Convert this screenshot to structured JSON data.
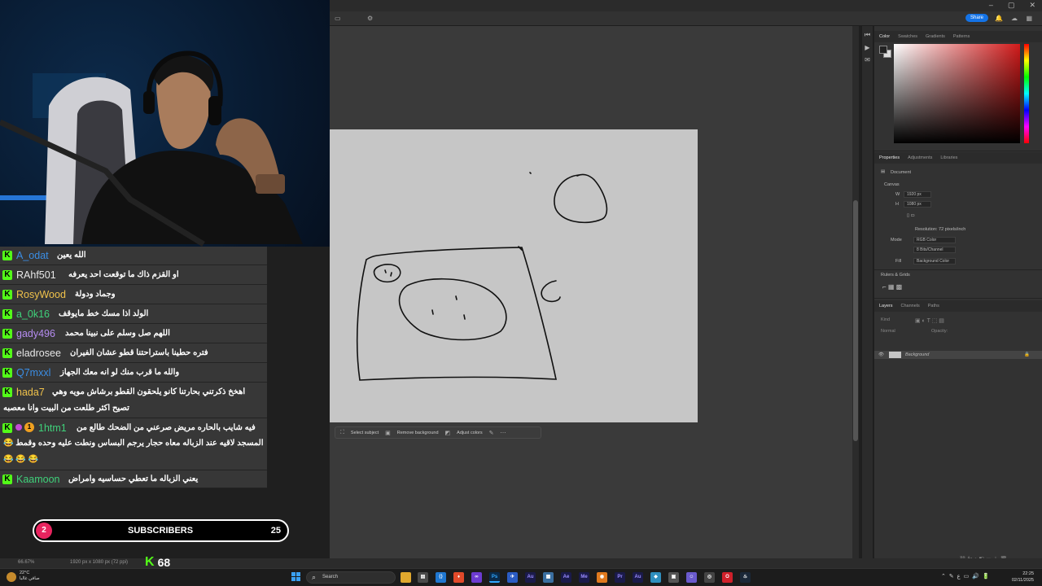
{
  "photoshop": {
    "share_label": "Share",
    "color_tabs": [
      "Color",
      "Swatches",
      "Gradients",
      "Patterns"
    ],
    "properties_tabs": [
      "Properties",
      "Adjustments",
      "Libraries"
    ],
    "document_label": "Document",
    "canvas_section": "Canvas",
    "width_value": "1920 px",
    "height_value": "1080 px",
    "resolution": "Resolution: 72 pixels/inch",
    "mode_label": "Mode",
    "mode_value": "RGB Color",
    "bit_value": "8 Bits/Channel",
    "fill_label": "Fill",
    "fill_value": "Background Color",
    "rulers_section": "Rulers & Grids",
    "layers_tabs": [
      "Layers",
      "Channels",
      "Paths"
    ],
    "layer_kind": "Kind",
    "layer_blend": "Normal",
    "layer_opacity": "Opacity:",
    "layer_name": "Background",
    "zoom": "66.67%",
    "doc_info": "1920 px x 1080 px (72 ppi)",
    "context_bar": {
      "select_subject": "Select subject",
      "remove_background": "Remove background",
      "adjust_colors": "Adjust colors"
    }
  },
  "chat": {
    "messages": [
      {
        "user": "A_odat",
        "color": "#3b8ee5",
        "text": "الله يعين"
      },
      {
        "user": "RAhf501",
        "color": "#e8e8e8",
        "text": "او القزم ذاك ما توقعت احد يعرفه"
      },
      {
        "user": "RosyWood",
        "color": "#f0c24b",
        "text": "وجماد ودولة"
      },
      {
        "user": "a_0k16",
        "color": "#3fd17a",
        "text": "الولد اذا مسك خط مايوقف"
      },
      {
        "user": "gady496",
        "color": "#b58cf0",
        "text": "اللهم صل وسلم على نبينا محمد"
      },
      {
        "user": "eladrosee",
        "color": "#e8e8e8",
        "text": "فتره حطينا باستراحتنا قطو عشان الفيران"
      },
      {
        "user": "Q7mxxl",
        "color": "#3b8ee5",
        "text": "والله ما قرب منك لو انه معك الجهاز"
      },
      {
        "user": "hada7",
        "color": "#f0c24b",
        "text": "اهخخ ذكرتني بحارتنا كانو يلحقون القطو برشاش مويه وهي",
        "line2": "تصيح اكثر طلعت من البيت وانا معصبه"
      },
      {
        "user": "1htm1",
        "color": "#3fd17a",
        "text": "فيه شايب بالحاره مريض صرعني من الضحك طالع من",
        "line2": "😂 المسجد لاقيه عند الزباله معاه حجار يرجم البساس ونطت عليه وحده وقمط",
        "line3": "😂 😂 😂"
      },
      {
        "user": "Kaamoon",
        "color": "#3fd17a",
        "text": "يعني الزباله ما تعطي حساسيه وامراض"
      }
    ]
  },
  "subscribers": {
    "current": "2",
    "label": "SUBSCRIBERS",
    "goal": "25"
  },
  "viewers": {
    "count": "68"
  },
  "taskbar": {
    "search": "Search",
    "weather_temp": "22°C",
    "weather_desc": "صافي غالبا",
    "time": "22:25",
    "date": "02/11/2025",
    "lang": "ع"
  }
}
